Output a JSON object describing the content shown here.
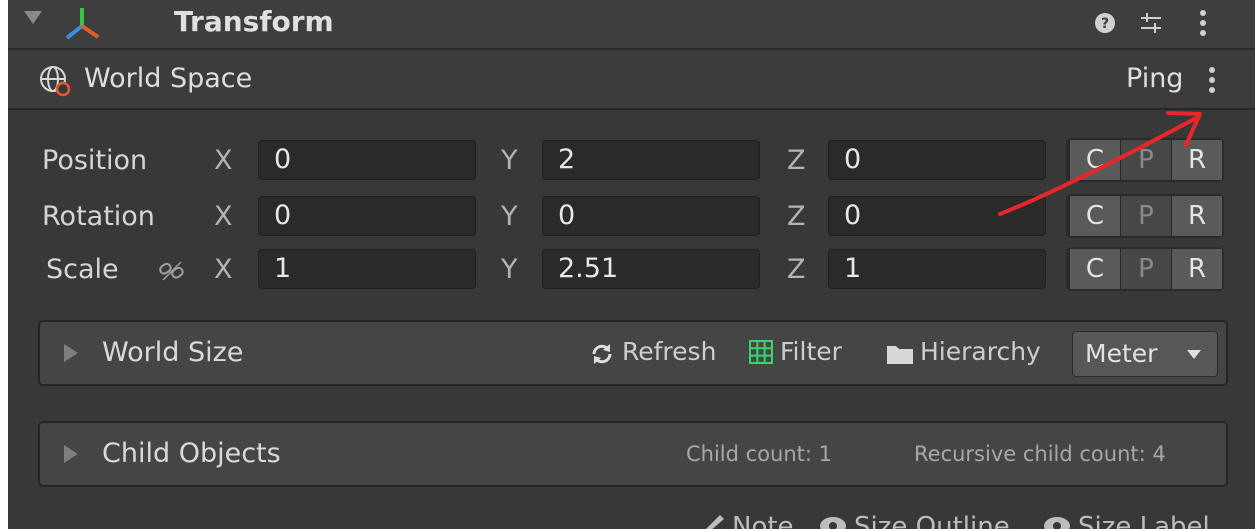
{
  "component": {
    "title": "Transform",
    "help_icon": "help-circle-icon",
    "settings_icon": "sliders-icon",
    "menu_icon": "kebab-menu-icon"
  },
  "world_space": {
    "label": "World Space",
    "ping": "Ping",
    "menu_icon": "kebab-menu-icon"
  },
  "transform": {
    "rows": [
      {
        "label": "Position",
        "x": "0",
        "y": "2",
        "z": "0"
      },
      {
        "label": "Rotation",
        "x": "0",
        "y": "0",
        "z": "0"
      },
      {
        "label": "Scale",
        "x": "1",
        "y": "2.51",
        "z": "1"
      }
    ],
    "axes": {
      "x": "X",
      "y": "Y",
      "z": "Z"
    },
    "buttons": {
      "copy": "C",
      "paste": "P",
      "reset": "R"
    }
  },
  "world_size": {
    "label": "World Size",
    "refresh": "Refresh",
    "filter": "Filter",
    "hierarchy": "Hierarchy",
    "unit": "Meter"
  },
  "child_objects": {
    "label": "Child Objects",
    "child_count": "Child count: 1",
    "recursive_count": "Recursive child count: 4"
  },
  "footer": {
    "note": "Note",
    "size_outline": "Size Outline",
    "size_label": "Size Label"
  },
  "colors": {
    "panel_bg": "#383838",
    "field_bg": "#2a2a2a",
    "annotation_red": "#e8262c",
    "filter_green": "#3cd26e"
  }
}
